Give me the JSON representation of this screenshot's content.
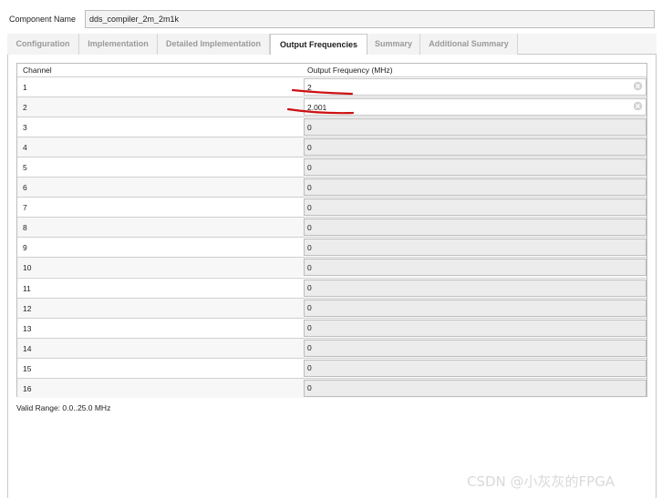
{
  "component": {
    "label": "Component Name",
    "value": "dds_compiler_2m_2m1k"
  },
  "tabs": [
    {
      "label": "Configuration",
      "active": false
    },
    {
      "label": "Implementation",
      "active": false
    },
    {
      "label": "Detailed Implementation",
      "active": false
    },
    {
      "label": "Output Frequencies",
      "active": true
    },
    {
      "label": "Summary",
      "active": false
    },
    {
      "label": "Additional Summary",
      "active": false
    }
  ],
  "table": {
    "headers": {
      "channel": "Channel",
      "frequency": "Output Frequency (MHz)"
    },
    "rows": [
      {
        "channel": "1",
        "value": "2",
        "editable": true
      },
      {
        "channel": "2",
        "value": "2.001",
        "editable": true
      },
      {
        "channel": "3",
        "value": "0",
        "editable": false
      },
      {
        "channel": "4",
        "value": "0",
        "editable": false
      },
      {
        "channel": "5",
        "value": "0",
        "editable": false
      },
      {
        "channel": "6",
        "value": "0",
        "editable": false
      },
      {
        "channel": "7",
        "value": "0",
        "editable": false
      },
      {
        "channel": "8",
        "value": "0",
        "editable": false
      },
      {
        "channel": "9",
        "value": "0",
        "editable": false
      },
      {
        "channel": "10",
        "value": "0",
        "editable": false
      },
      {
        "channel": "11",
        "value": "0",
        "editable": false
      },
      {
        "channel": "12",
        "value": "0",
        "editable": false
      },
      {
        "channel": "13",
        "value": "0",
        "editable": false
      },
      {
        "channel": "14",
        "value": "0",
        "editable": false
      },
      {
        "channel": "15",
        "value": "0",
        "editable": false
      },
      {
        "channel": "16",
        "value": "0",
        "editable": false
      }
    ]
  },
  "valid_range": "Valid Range: 0.0..25.0 MHz",
  "watermark": "CSDN @小灰灰的FPGA",
  "icons": {
    "clear": "clear-circle-icon"
  },
  "colors": {
    "annotation": "#cc1111",
    "active_tab_text": "#1c1c1c",
    "inactive_tab_text": "#9a9a9a"
  }
}
